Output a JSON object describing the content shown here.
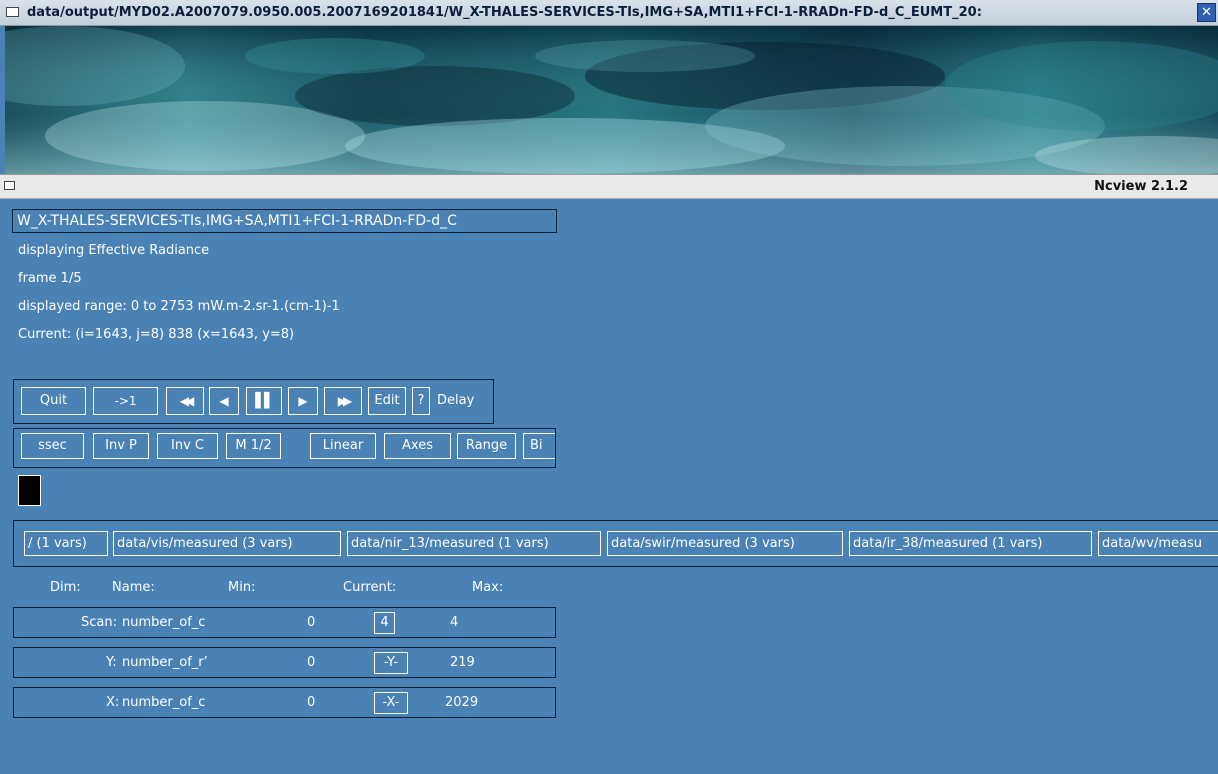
{
  "image_window": {
    "title": "data/output/MYD02.A2007079.0950.005.2007169201841/W_X-THALES-SERVICES-TIs,IMG+SA,MTI1+FCI-1-RRADn-FD-d_C_EUMT_20:",
    "close_glyph": "✕"
  },
  "main_window": {
    "app_name": "Ncview 2.1.2"
  },
  "info": {
    "file": "W_X-THALES-SERVICES-TIs,IMG+SA,MTI1+FCI-1-RRADn-FD-d_C",
    "displaying": "displaying Effective Radiance",
    "frame": "frame 1/5",
    "range": "displayed range: 0 to 2753 mW.m-2.sr-1.(cm-1)-1",
    "current": "Current: (i=1643, j=8) 838 (x=1643, y=8)"
  },
  "toolbar1": {
    "quit": "Quit",
    "goto_first": "->1",
    "rewind": "◀◀",
    "back": "◀",
    "pause": "▌▌",
    "forward": "▶",
    "fast_forward": "▶▶",
    "edit": "Edit",
    "help": "?",
    "delay": "Delay"
  },
  "toolbar2": {
    "colormap": "ssec",
    "inv_p": "Inv P",
    "inv_c": "Inv C",
    "mag": "M 1/2",
    "transform": "Linear",
    "axes": "Axes",
    "range": "Range",
    "bi": "Bi"
  },
  "var_groups": [
    "/ (1 vars)",
    "data/vis/measured (3 vars)",
    "data/nir_13/measured (1 vars)",
    "data/swir/measured (3 vars)",
    "data/ir_38/measured (1 vars)",
    "data/wv/measu"
  ],
  "dims_header": {
    "dim": "Dim:",
    "name": "Name:",
    "min": "Min:",
    "current": "Current:",
    "max": "Max:"
  },
  "dims": [
    {
      "dim": "Scan:",
      "name": "number_of_c",
      "min": "0",
      "current": "4",
      "max": "4"
    },
    {
      "dim": "Y:",
      "name": "number_of_r’",
      "min": "0",
      "current": "-Y-",
      "max": "219"
    },
    {
      "dim": "X:",
      "name": "number_of_c",
      "min": "0",
      "current": "-X-",
      "max": "2029"
    }
  ],
  "colors": {
    "panel_bg": "#4a82b6",
    "titlebar": "#c9d4df"
  }
}
